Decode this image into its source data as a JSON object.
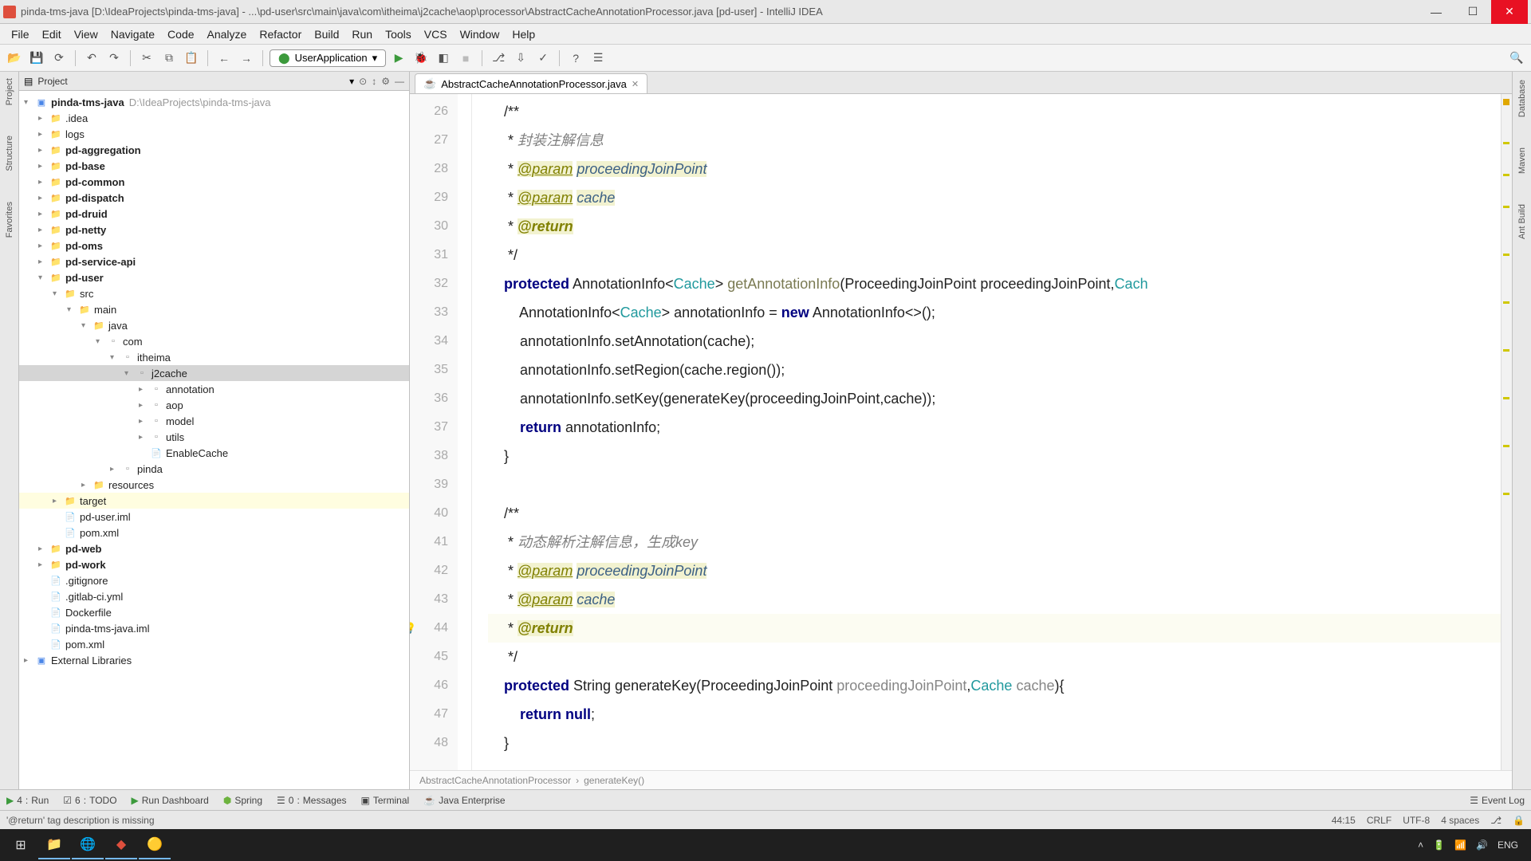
{
  "titlebar": {
    "text": "pinda-tms-java [D:\\IdeaProjects\\pinda-tms-java] - ...\\pd-user\\src\\main\\java\\com\\itheima\\j2cache\\aop\\processor\\AbstractCacheAnnotationProcessor.java [pd-user] - IntelliJ IDEA"
  },
  "menu": [
    "File",
    "Edit",
    "View",
    "Navigate",
    "Code",
    "Analyze",
    "Refactor",
    "Build",
    "Run",
    "Tools",
    "VCS",
    "Window",
    "Help"
  ],
  "run_config": "UserApplication",
  "project_header": "Project",
  "tree": [
    {
      "d": 0,
      "a": "▾",
      "ic": "module",
      "label": "pinda-tms-java",
      "bold": true,
      "path": "D:\\IdeaProjects\\pinda-tms-java"
    },
    {
      "d": 1,
      "a": "▸",
      "ic": "folder",
      "label": ".idea"
    },
    {
      "d": 1,
      "a": "▸",
      "ic": "folder",
      "label": "logs"
    },
    {
      "d": 1,
      "a": "▸",
      "ic": "folder",
      "label": "pd-aggregation",
      "bold": true
    },
    {
      "d": 1,
      "a": "▸",
      "ic": "folder",
      "label": "pd-base",
      "bold": true
    },
    {
      "d": 1,
      "a": "▸",
      "ic": "folder",
      "label": "pd-common",
      "bold": true
    },
    {
      "d": 1,
      "a": "▸",
      "ic": "folder",
      "label": "pd-dispatch",
      "bold": true
    },
    {
      "d": 1,
      "a": "▸",
      "ic": "folder",
      "label": "pd-druid",
      "bold": true
    },
    {
      "d": 1,
      "a": "▸",
      "ic": "folder",
      "label": "pd-netty",
      "bold": true
    },
    {
      "d": 1,
      "a": "▸",
      "ic": "folder",
      "label": "pd-oms",
      "bold": true
    },
    {
      "d": 1,
      "a": "▸",
      "ic": "folder",
      "label": "pd-service-api",
      "bold": true
    },
    {
      "d": 1,
      "a": "▾",
      "ic": "folder",
      "label": "pd-user",
      "bold": true
    },
    {
      "d": 2,
      "a": "▾",
      "ic": "folder",
      "label": "src"
    },
    {
      "d": 3,
      "a": "▾",
      "ic": "folder",
      "label": "main"
    },
    {
      "d": 4,
      "a": "▾",
      "ic": "folder",
      "label": "java"
    },
    {
      "d": 5,
      "a": "▾",
      "ic": "pkg",
      "label": "com"
    },
    {
      "d": 6,
      "a": "▾",
      "ic": "pkg",
      "label": "itheima"
    },
    {
      "d": 7,
      "a": "▾",
      "ic": "pkg",
      "label": "j2cache",
      "sel": true
    },
    {
      "d": 8,
      "a": "▸",
      "ic": "pkg",
      "label": "annotation"
    },
    {
      "d": 8,
      "a": "▸",
      "ic": "pkg",
      "label": "aop"
    },
    {
      "d": 8,
      "a": "▸",
      "ic": "pkg",
      "label": "model"
    },
    {
      "d": 8,
      "a": "▸",
      "ic": "pkg",
      "label": "utils"
    },
    {
      "d": 8,
      "a": " ",
      "ic": "file",
      "label": "EnableCache"
    },
    {
      "d": 6,
      "a": "▸",
      "ic": "pkg",
      "label": "pinda"
    },
    {
      "d": 4,
      "a": "▸",
      "ic": "folder",
      "label": "resources"
    },
    {
      "d": 2,
      "a": "▸",
      "ic": "target",
      "label": "target",
      "hl": true
    },
    {
      "d": 2,
      "a": " ",
      "ic": "file",
      "label": "pd-user.iml"
    },
    {
      "d": 2,
      "a": " ",
      "ic": "file",
      "label": "pom.xml"
    },
    {
      "d": 1,
      "a": "▸",
      "ic": "folder",
      "label": "pd-web",
      "bold": true
    },
    {
      "d": 1,
      "a": "▸",
      "ic": "folder",
      "label": "pd-work",
      "bold": true
    },
    {
      "d": 1,
      "a": " ",
      "ic": "file",
      "label": ".gitignore"
    },
    {
      "d": 1,
      "a": " ",
      "ic": "file",
      "label": ".gitlab-ci.yml"
    },
    {
      "d": 1,
      "a": " ",
      "ic": "file",
      "label": "Dockerfile"
    },
    {
      "d": 1,
      "a": " ",
      "ic": "file",
      "label": "pinda-tms-java.iml"
    },
    {
      "d": 1,
      "a": " ",
      "ic": "file",
      "label": "pom.xml"
    },
    {
      "d": 0,
      "a": "▸",
      "ic": "module",
      "label": "External Libraries"
    }
  ],
  "editor_tab": "AbstractCacheAnnotationProcessor.java",
  "code_lines": [
    {
      "n": 26,
      "html": "    /**"
    },
    {
      "n": 27,
      "html": "     * <span class='str'>封装注解信息</span>"
    },
    {
      "n": 28,
      "html": "     * <span class='ann'>@param</span> <span class='ann-param'>proceedingJoinPoint</span>"
    },
    {
      "n": 29,
      "html": "     * <span class='ann'>@param</span> <span class='ann-param'>cache</span>"
    },
    {
      "n": 30,
      "html": "     * <span class='ann-name'>@return</span>"
    },
    {
      "n": 31,
      "html": "     */"
    },
    {
      "n": 32,
      "html": "    <span class='kw'>protected</span> AnnotationInfo&lt;<span class='type'>Cache</span>&gt; <span class='method'>getAnnotationInfo</span>(ProceedingJoinPoint proceedingJoinPoint,<span class='type'>Cach</span>"
    },
    {
      "n": 33,
      "html": "        AnnotationInfo&lt;<span class='type'>Cache</span>&gt; annotationInfo = <span class='kw'>new</span> AnnotationInfo&lt;&gt;();"
    },
    {
      "n": 34,
      "html": "        annotationInfo.setAnnotation(cache);"
    },
    {
      "n": 35,
      "html": "        annotationInfo.setRegion(cache.region());"
    },
    {
      "n": 36,
      "html": "        annotationInfo.setKey(generateKey(proceedingJoinPoint,cache));"
    },
    {
      "n": 37,
      "html": "        <span class='kw'>return</span> annotationInfo;"
    },
    {
      "n": 38,
      "html": "    }"
    },
    {
      "n": 39,
      "html": ""
    },
    {
      "n": 40,
      "html": "    /**"
    },
    {
      "n": 41,
      "html": "     * <span class='str'>动态解析注解信息，生成key</span>"
    },
    {
      "n": 42,
      "html": "     * <span class='ann'>@param</span> <span class='ann-param'>proceedingJoinPoint</span>"
    },
    {
      "n": 43,
      "html": "     * <span class='ann'>@param</span> <span class='ann-param'>cache</span>"
    },
    {
      "n": 44,
      "html": "     * <span class='ann-name'>@return</span>",
      "hl": true,
      "bulb": true
    },
    {
      "n": 45,
      "html": "     */"
    },
    {
      "n": 46,
      "html": "    <span class='kw'>protected</span> String generateKey(ProceedingJoinPoint <span class='param'>proceedingJoinPoint</span>,<span class='type'>Cache</span> <span class='param'>cache</span>){"
    },
    {
      "n": 47,
      "html": "        <span class='kw'>return</span> <span class='lit'>null</span>;"
    },
    {
      "n": 48,
      "html": "    }"
    }
  ],
  "breadcrumb": [
    "AbstractCacheAnnotationProcessor",
    "generateKey()"
  ],
  "bottom_tools": {
    "run": "Run",
    "todo": "TODO",
    "dashboard": "Run Dashboard",
    "spring": "Spring",
    "messages": "Messages",
    "terminal": "Terminal",
    "javaee": "Java Enterprise",
    "eventlog": "Event Log",
    "run_n": "4",
    "todo_n": "6",
    "messages_n": "0"
  },
  "status": {
    "msg": "'@return' tag description is missing",
    "pos": "44:15",
    "crlf": "CRLF",
    "enc": "UTF-8",
    "spaces": "4 spaces"
  },
  "taskbar": {
    "lang": "ENG"
  },
  "left_rail": [
    "Project",
    "Structure",
    "Favorites"
  ],
  "right_rail": [
    "Database",
    "Maven",
    "Ant Build"
  ]
}
